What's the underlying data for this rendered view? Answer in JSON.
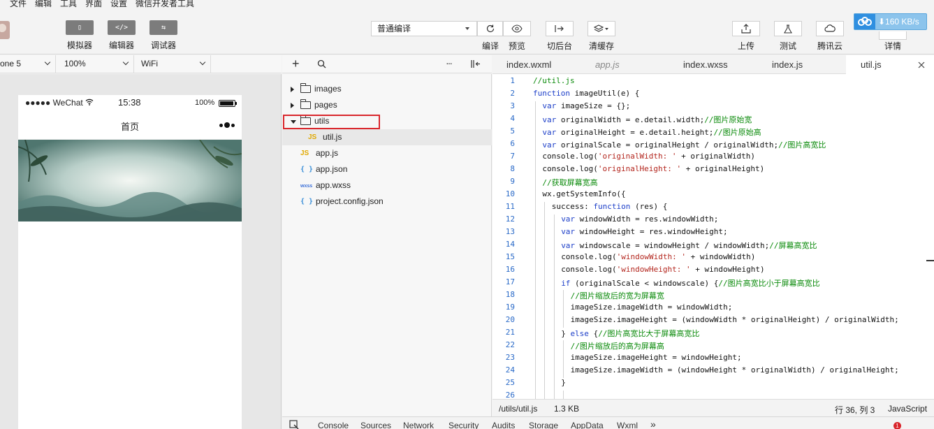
{
  "menu": [
    "文件",
    "编辑",
    "工具",
    "界面",
    "设置",
    "微信开发者工具"
  ],
  "toolbar": {
    "modes": [
      {
        "glyph": "▯",
        "label": "模拟器"
      },
      {
        "glyph": "</>",
        "label": "编辑器"
      },
      {
        "glyph": "⇆",
        "label": "调试器"
      }
    ],
    "compile_mode": "普通编译",
    "compile_label": "编译",
    "preview_label": "预览",
    "backend_label": "切后台",
    "cache_label": "清缓存",
    "upload_label": "上传",
    "test_label": "测试",
    "cloud_label": "腾讯云",
    "detail_label": "详情",
    "net_speed": "⬇160 KB/s"
  },
  "simulator": {
    "device": "one 5",
    "zoom": "100%",
    "network": "WiFi",
    "carrier": "●●●●● WeChat",
    "time": "15:38",
    "battery_pct": "100%",
    "nav_title": "首页"
  },
  "explorer": {
    "tree": [
      {
        "type": "folder",
        "name": "images",
        "open": false,
        "depth": 0
      },
      {
        "type": "folder",
        "name": "pages",
        "open": false,
        "depth": 0
      },
      {
        "type": "folder",
        "name": "utils",
        "open": true,
        "depth": 0
      },
      {
        "type": "js",
        "name": "util.js",
        "depth": 1,
        "selected": true
      },
      {
        "type": "js",
        "name": "app.js",
        "depth": 0
      },
      {
        "type": "json",
        "name": "app.json",
        "depth": 0
      },
      {
        "type": "wxss",
        "name": "app.wxss",
        "depth": 0
      },
      {
        "type": "json",
        "name": "project.config.json",
        "depth": 0
      }
    ],
    "icons": {
      "add": "+",
      "search": "search-icon",
      "more": "···"
    }
  },
  "editor": {
    "tabs": [
      {
        "label": "index.wxml",
        "italic": false,
        "active": false
      },
      {
        "label": "app.js",
        "italic": true,
        "active": false
      },
      {
        "label": "index.wxss",
        "italic": false,
        "active": false
      },
      {
        "label": "index.js",
        "italic": false,
        "active": false
      },
      {
        "label": "util.js",
        "italic": false,
        "active": true
      }
    ],
    "lines": [
      {
        "n": 1,
        "indent": 0,
        "html": "<span class=\"cm\">//util.js</span>"
      },
      {
        "n": 2,
        "indent": 0,
        "html": "<span class=\"kw\">function</span> imageUtil(e) {"
      },
      {
        "n": 3,
        "indent": 1,
        "html": "<span class=\"kw\">var</span> imageSize = {};"
      },
      {
        "n": 4,
        "indent": 1,
        "html": "<span class=\"kw\">var</span> originalWidth = e.detail.width;<span class=\"cm\">//图片原始宽</span>"
      },
      {
        "n": 5,
        "indent": 1,
        "html": "<span class=\"kw\">var</span> originalHeight = e.detail.height;<span class=\"cm\">//图片原始高</span>"
      },
      {
        "n": 6,
        "indent": 1,
        "html": "<span class=\"kw\">var</span> originalScale = originalHeight / originalWidth;<span class=\"cm\">//图片高宽比</span>"
      },
      {
        "n": 7,
        "indent": 1,
        "html": "console.log(<span class=\"st\">'originalWidth: '</span> + originalWidth)"
      },
      {
        "n": 8,
        "indent": 1,
        "html": "console.log(<span class=\"st\">'originalHeight: '</span> + originalHeight)"
      },
      {
        "n": 9,
        "indent": 1,
        "html": "<span class=\"cm\">//获取屏幕宽高</span>"
      },
      {
        "n": 10,
        "indent": 1,
        "html": "wx.getSystemInfo({"
      },
      {
        "n": 11,
        "indent": 2,
        "html": "success: <span class=\"kw\">function</span> (res) {"
      },
      {
        "n": 12,
        "indent": 3,
        "html": "<span class=\"kw\">var</span> windowWidth = res.windowWidth;"
      },
      {
        "n": 13,
        "indent": 3,
        "html": "<span class=\"kw\">var</span> windowHeight = res.windowHeight;"
      },
      {
        "n": 14,
        "indent": 3,
        "html": "<span class=\"kw\">var</span> windowscale = windowHeight / windowWidth;<span class=\"cm\">//屏幕高宽比</span>"
      },
      {
        "n": 15,
        "indent": 3,
        "html": "console.log(<span class=\"st\">'windowWidth: '</span> + windowWidth)"
      },
      {
        "n": 16,
        "indent": 3,
        "html": "console.log(<span class=\"st\">'windowHeight: '</span> + windowHeight)"
      },
      {
        "n": 17,
        "indent": 3,
        "html": "<span class=\"kw\">if</span> (originalScale &lt; windowscale) {<span class=\"cm\">//图片高宽比小于屏幕高宽比</span>"
      },
      {
        "n": 18,
        "indent": 4,
        "html": "<span class=\"cm\">//图片缩放后的宽为屏幕宽</span>"
      },
      {
        "n": 19,
        "indent": 4,
        "html": "imageSize.imageWidth = windowWidth;"
      },
      {
        "n": 20,
        "indent": 4,
        "html": "imageSize.imageHeight = (windowWidth * originalHeight) / originalWidth;"
      },
      {
        "n": 21,
        "indent": 3,
        "html": "} <span class=\"kw\">else</span> {<span class=\"cm\">//图片高宽比大于屏幕高宽比</span>"
      },
      {
        "n": 22,
        "indent": 4,
        "html": "<span class=\"cm\">//图片缩放后的高为屏幕高</span>"
      },
      {
        "n": 23,
        "indent": 4,
        "html": "imageSize.imageHeight = windowHeight;"
      },
      {
        "n": 24,
        "indent": 4,
        "html": "imageSize.imageWidth = (windowHeight * originalWidth) / originalHeight;"
      },
      {
        "n": 25,
        "indent": 3,
        "html": "}"
      },
      {
        "n": 26,
        "indent": 0,
        "html": ""
      }
    ]
  },
  "statusbar": {
    "path": "/utils/util.js",
    "size": "1.3 KB",
    "position": "行 36, 列 3",
    "language": "JavaScript"
  },
  "devtools": {
    "tabs": [
      "Console",
      "Sources",
      "Network",
      "Security",
      "Audits",
      "Storage",
      "AppData",
      "Wxml"
    ],
    "more": "»",
    "error_count": "1"
  }
}
